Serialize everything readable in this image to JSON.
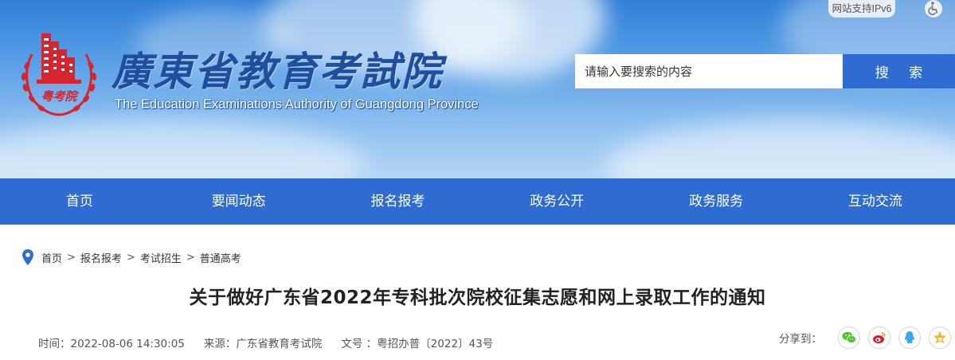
{
  "header": {
    "site_name_cn": "廣東省教育考試院",
    "site_name_en": "The Education Examinations Authority of Guangdong Province",
    "emblem_text": "粤考院",
    "ipv6_label": "网站支持IPv6",
    "accessibility_icon": "wheelchair-icon"
  },
  "search": {
    "placeholder": "请输入要搜索的内容",
    "button_label": "搜 索"
  },
  "nav": {
    "items": [
      {
        "label": "首页"
      },
      {
        "label": "要闻动态"
      },
      {
        "label": "报名报考"
      },
      {
        "label": "政务公开"
      },
      {
        "label": "政务服务"
      },
      {
        "label": "互动交流"
      }
    ]
  },
  "breadcrumb": {
    "icon": "location-pin-icon",
    "items": [
      "首页",
      "报名报考",
      "考试招生",
      "普通高考"
    ],
    "separator": ">"
  },
  "article": {
    "title": "关于做好广东省2022年专科批次院校征集志愿和网上录取工作的通知",
    "time": "时间：2022-08-06 14:30:05",
    "source": "来源：广东省教育考试院",
    "doc_no": "文号 ：粤招办普〔2022〕43号"
  },
  "share": {
    "label": "分享到：",
    "buttons": [
      {
        "icon": "wechat-icon",
        "color": "#51c332"
      },
      {
        "icon": "weibo-icon",
        "color": "#e6162d"
      },
      {
        "icon": "qq-icon",
        "color": "#3ca8e8"
      },
      {
        "icon": "qzone-icon",
        "color": "#f5b51d"
      }
    ]
  },
  "colors": {
    "primary_blue": "#2f6cd2",
    "title_blue": "#1f4e9c",
    "emblem_red": "#d6252e"
  }
}
